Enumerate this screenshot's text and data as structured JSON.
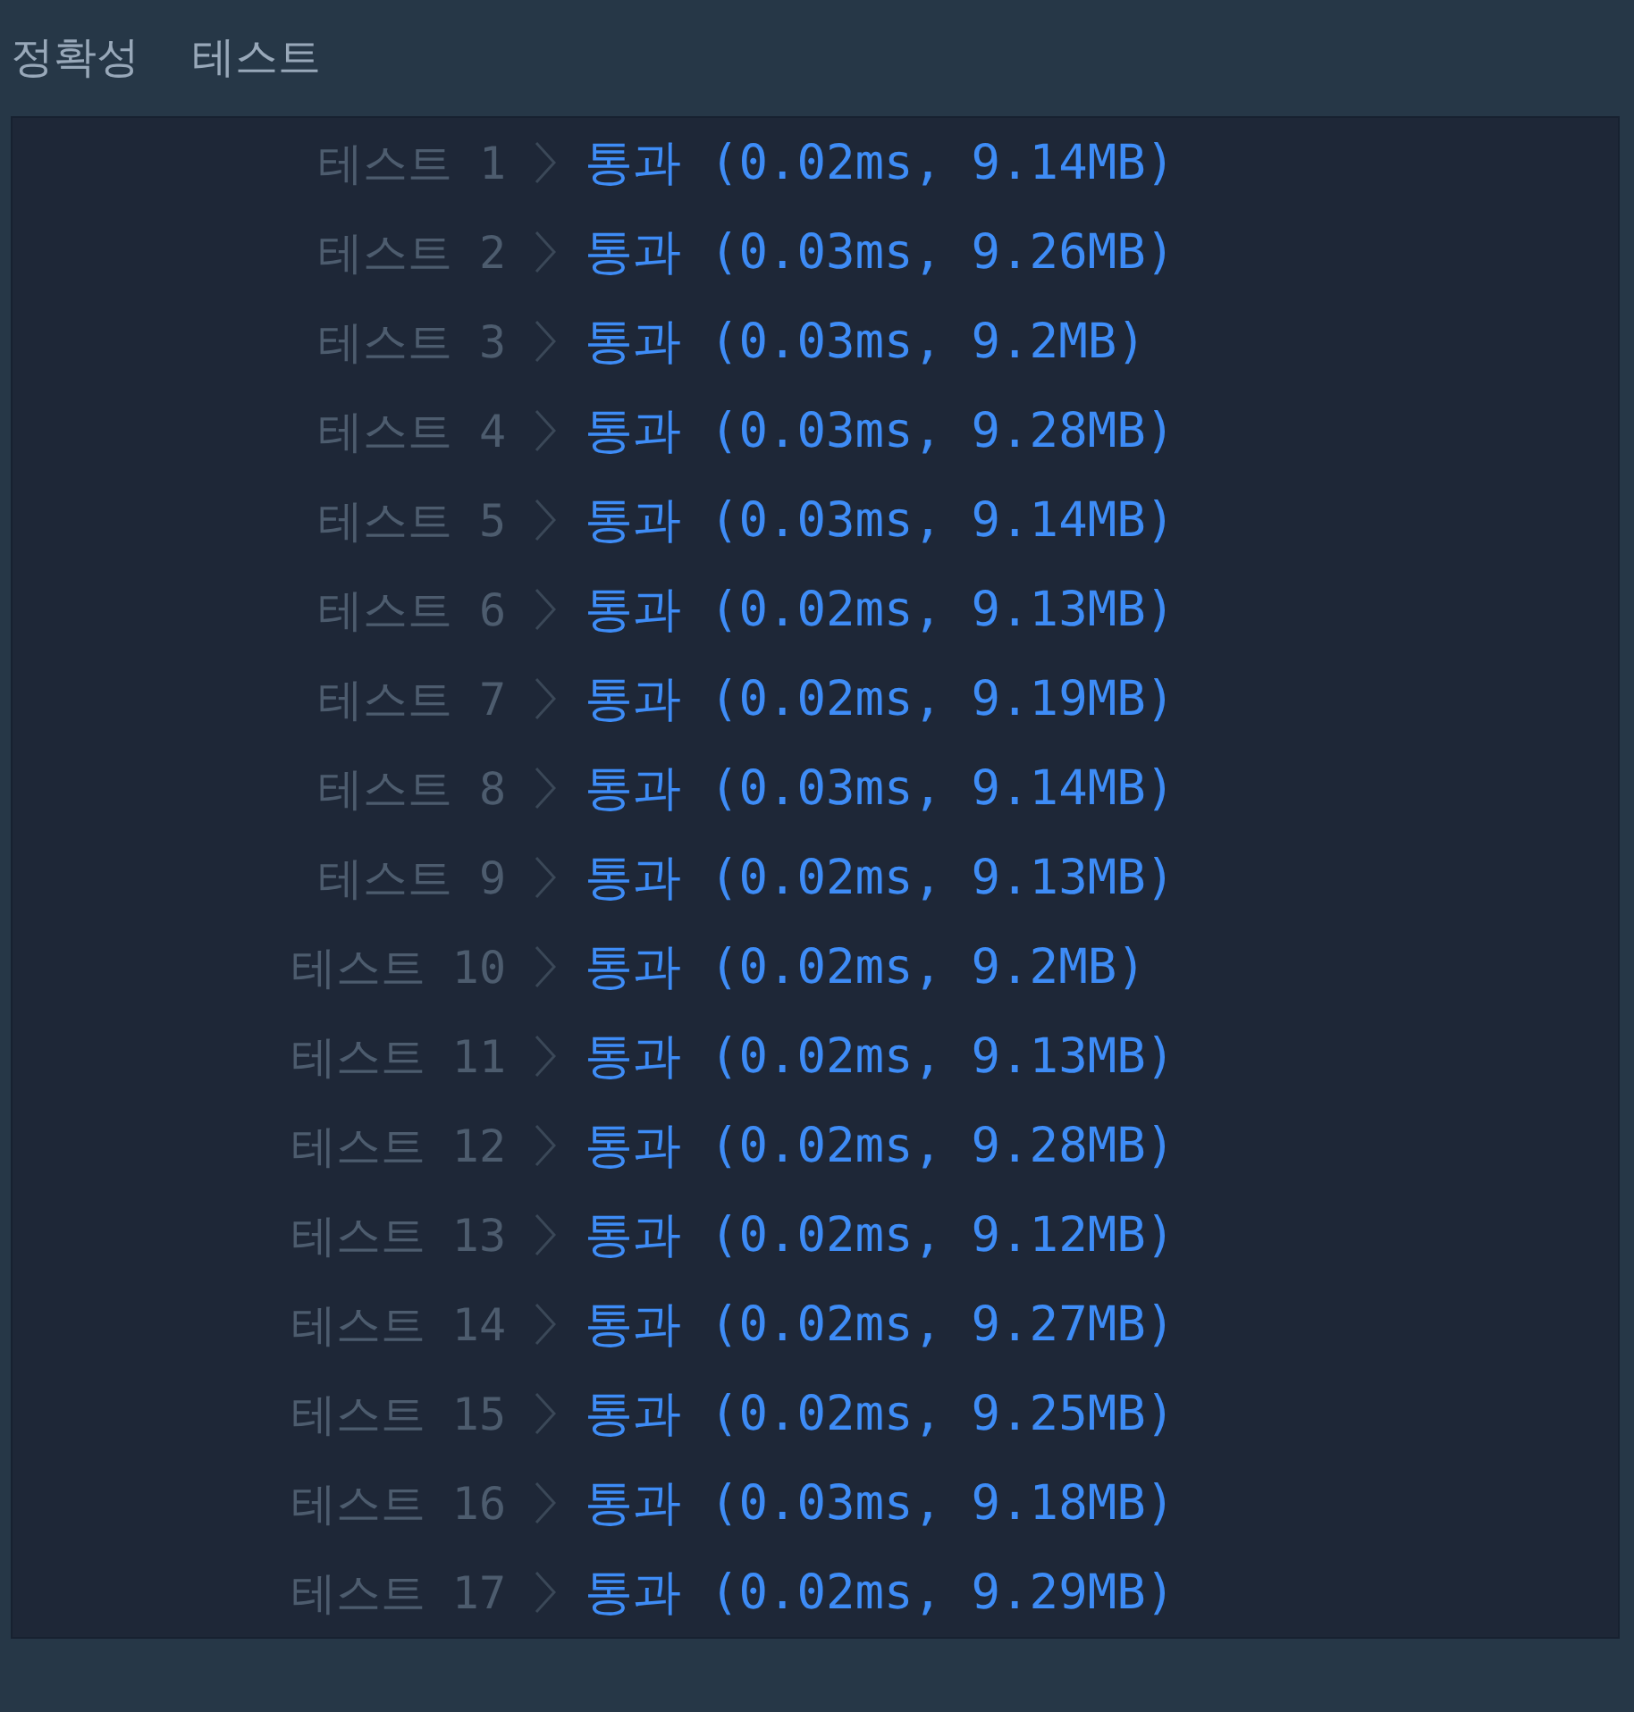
{
  "heading": "정확성 테스트",
  "results": [
    {
      "label": "테스트 1",
      "kind": "pass",
      "status": "통과",
      "detail": "(0.02ms, 9.14MB)"
    },
    {
      "label": "테스트 2",
      "kind": "pass",
      "status": "통과",
      "detail": "(0.03ms, 9.26MB)"
    },
    {
      "label": "테스트 3",
      "kind": "pass",
      "status": "통과",
      "detail": "(0.03ms, 9.2MB)"
    },
    {
      "label": "테스트 4",
      "kind": "pass",
      "status": "통과",
      "detail": "(0.03ms, 9.28MB)"
    },
    {
      "label": "테스트 5",
      "kind": "pass",
      "status": "통과",
      "detail": "(0.03ms, 9.14MB)"
    },
    {
      "label": "테스트 6",
      "kind": "pass",
      "status": "통과",
      "detail": "(0.02ms, 9.13MB)"
    },
    {
      "label": "테스트 7",
      "kind": "pass",
      "status": "통과",
      "detail": "(0.02ms, 9.19MB)"
    },
    {
      "label": "테스트 8",
      "kind": "pass",
      "status": "통과",
      "detail": "(0.03ms, 9.14MB)"
    },
    {
      "label": "테스트 9",
      "kind": "pass",
      "status": "통과",
      "detail": "(0.02ms, 9.13MB)"
    },
    {
      "label": "테스트 10",
      "kind": "pass",
      "status": "통과",
      "detail": "(0.02ms, 9.2MB)"
    },
    {
      "label": "테스트 11",
      "kind": "pass",
      "status": "통과",
      "detail": "(0.02ms, 9.13MB)"
    },
    {
      "label": "테스트 12",
      "kind": "pass",
      "status": "통과",
      "detail": "(0.02ms, 9.28MB)"
    },
    {
      "label": "테스트 13",
      "kind": "pass",
      "status": "통과",
      "detail": "(0.02ms, 9.12MB)"
    },
    {
      "label": "테스트 14",
      "kind": "pass",
      "status": "통과",
      "detail": "(0.02ms, 9.27MB)"
    },
    {
      "label": "테스트 15",
      "kind": "pass",
      "status": "통과",
      "detail": "(0.02ms, 9.25MB)"
    },
    {
      "label": "테스트 16",
      "kind": "pass",
      "status": "통과",
      "detail": "(0.03ms, 9.18MB)"
    },
    {
      "label": "테스트 17",
      "kind": "pass",
      "status": "통과",
      "detail": "(0.02ms, 9.29MB)"
    }
  ]
}
